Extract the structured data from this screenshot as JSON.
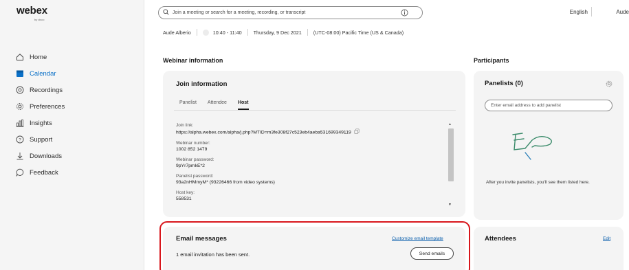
{
  "brand": {
    "logo": "webex",
    "sub": "by cisco"
  },
  "sidebar": {
    "items": [
      {
        "label": "Home",
        "icon": "home-icon"
      },
      {
        "label": "Calendar",
        "icon": "calendar-icon",
        "active": true
      },
      {
        "label": "Recordings",
        "icon": "recordings-icon"
      },
      {
        "label": "Preferences",
        "icon": "gear-icon"
      },
      {
        "label": "Insights",
        "icon": "insights-icon"
      },
      {
        "label": "Support",
        "icon": "support-icon"
      },
      {
        "label": "Downloads",
        "icon": "download-icon"
      },
      {
        "label": "Feedback",
        "icon": "feedback-icon"
      }
    ]
  },
  "topbar": {
    "search_placeholder": "Join a meeting or search for a meeting, recording, or transcript",
    "language": "English",
    "user": "Aude"
  },
  "meeting": {
    "host": "Aude Alberio",
    "time": "10:40 - 11:40",
    "date": "Thursday, 9 Dec 2021",
    "timezone": "(UTC-08:00) Pacific Time (US & Canada)"
  },
  "webinar": {
    "section_title": "Webinar information",
    "join_title": "Join information",
    "tabs": [
      "Panelist",
      "Attendee",
      "Host"
    ],
    "active_tab": "Host",
    "fields": [
      {
        "label": "Join link:",
        "value": "https://alpha.webex.com/alpha/j.php?MTID=m3fe308f27c523eb4aeba531699349119"
      },
      {
        "label": "Webinar number:",
        "value": "1002 852 1479"
      },
      {
        "label": "Webinar password:",
        "value": "9pYr7pmkE*2"
      },
      {
        "label": "Panelist password:",
        "value": "93a2nHMmyM* (93226466 from video systems)"
      },
      {
        "label": "Host key:",
        "value": "558531"
      }
    ]
  },
  "email": {
    "title": "Email messages",
    "customize_link": "Customize email template",
    "status": "1 email invitation has been sent.",
    "send_button": "Send emails"
  },
  "participants": {
    "section_title": "Participants",
    "panelists_title": "Panelists (0)",
    "panelist_placeholder": "Enter email address to add panelist",
    "empty_message": "After you invite panelists, you'll see them listed here.",
    "attendees_title": "Attendees",
    "edit_link": "Edit"
  },
  "colors": {
    "accent": "#0a70c7",
    "link": "#0a5fad",
    "highlight": "#d8161c",
    "card": "#f4f4f4"
  }
}
